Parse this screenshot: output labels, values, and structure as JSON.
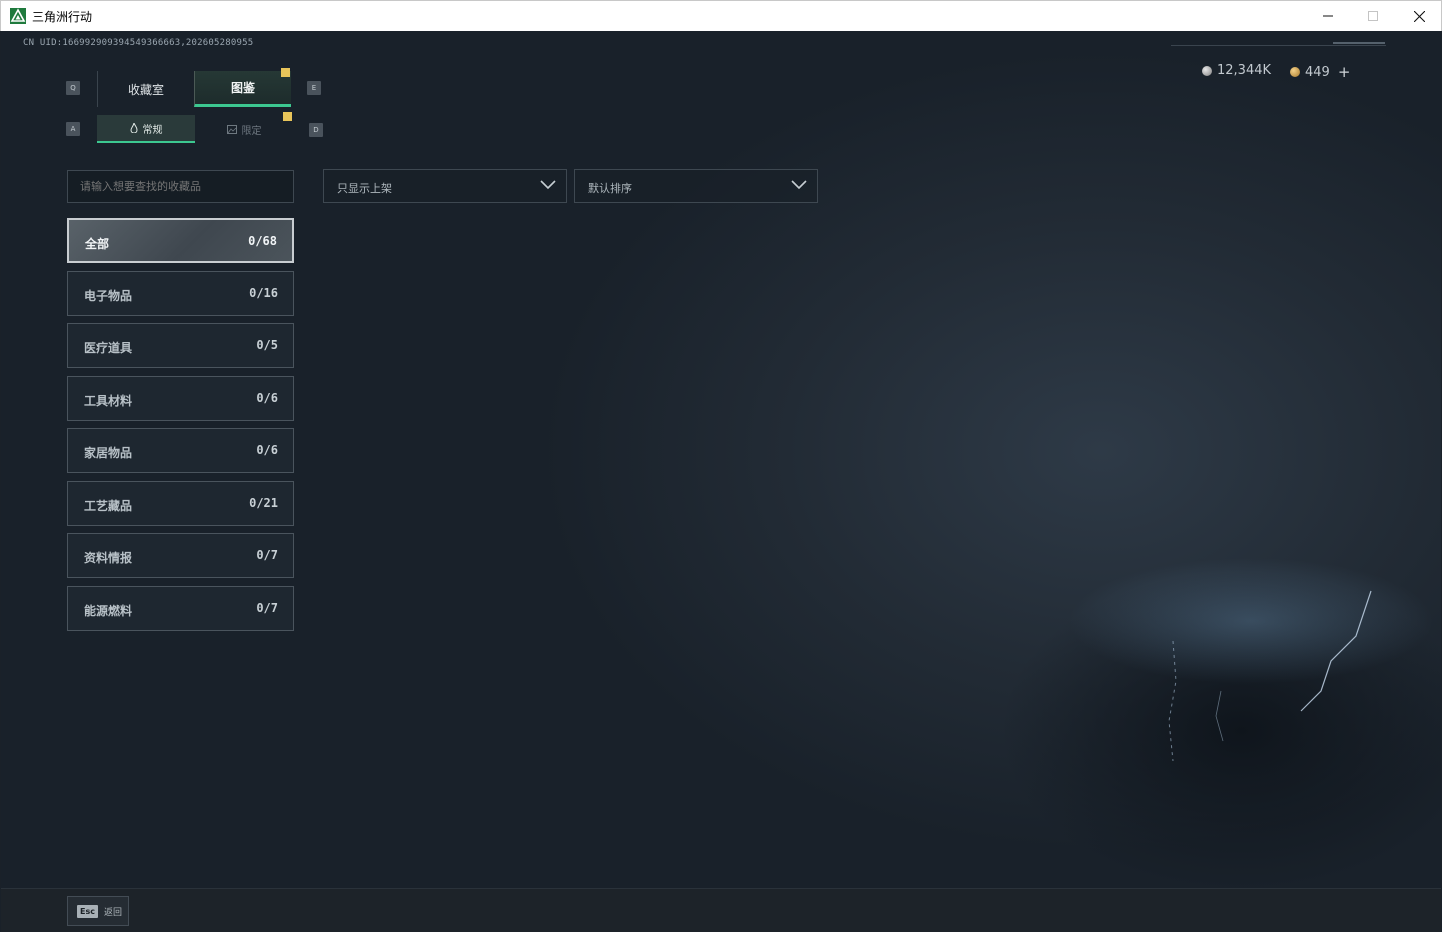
{
  "window": {
    "title": "三角洲行动",
    "minimize_icon": "minimize-icon",
    "maximize_icon": "maximize-icon",
    "close_icon": "close-icon"
  },
  "header": {
    "uid_text": "CN UID:166992909394549366663,202605280955"
  },
  "currency": {
    "silver": "12,344K",
    "gold": "449",
    "add_label": "+"
  },
  "keys": {
    "prev_main": "Q",
    "next_main": "E",
    "prev_sub": "A",
    "next_sub": "D"
  },
  "tabs": {
    "main": [
      {
        "label": "收藏室",
        "active": false
      },
      {
        "label": "图鉴",
        "active": true
      }
    ],
    "sub": [
      {
        "label": "常规",
        "active": true,
        "icon": "flame-icon"
      },
      {
        "label": "限定",
        "active": false,
        "icon": "image-icon"
      }
    ]
  },
  "search": {
    "placeholder": "请输入想要查找的收藏品"
  },
  "filters": {
    "display": "只显示上架",
    "sort": "默认排序"
  },
  "categories": [
    {
      "label": "全部",
      "count": "0/68",
      "active": true
    },
    {
      "label": "电子物品",
      "count": "0/16",
      "active": false
    },
    {
      "label": "医疗道具",
      "count": "0/5",
      "active": false
    },
    {
      "label": "工具材料",
      "count": "0/6",
      "active": false
    },
    {
      "label": "家居物品",
      "count": "0/6",
      "active": false
    },
    {
      "label": "工艺藏品",
      "count": "0/21",
      "active": false
    },
    {
      "label": "资料情报",
      "count": "0/7",
      "active": false
    },
    {
      "label": "能源燃料",
      "count": "0/7",
      "active": false
    }
  ],
  "footer": {
    "esc_key": "Esc",
    "back_label": "返回"
  },
  "colors": {
    "accent": "#3cc890",
    "badge": "#e8c55a",
    "background": "#1a2129"
  }
}
